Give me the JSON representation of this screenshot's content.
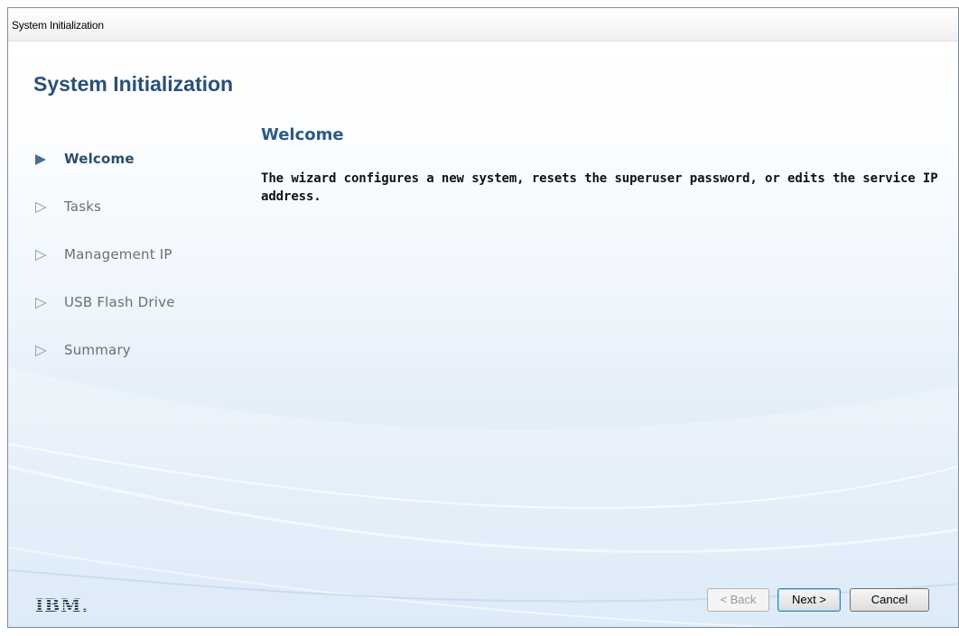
{
  "window": {
    "title": "System Initialization"
  },
  "header": {
    "title": "System Initialization"
  },
  "steps": [
    {
      "label": "Welcome",
      "active": true
    },
    {
      "label": "Tasks",
      "active": false
    },
    {
      "label": "Management IP",
      "active": false
    },
    {
      "label": "USB Flash Drive",
      "active": false
    },
    {
      "label": "Summary",
      "active": false
    }
  ],
  "content": {
    "title": "Welcome",
    "text": "The wizard configures a new system, resets the superuser password, or edits the service IP address."
  },
  "footer": {
    "logo": "IBM.",
    "back_label": "< Back",
    "back_enabled": false,
    "next_label": "Next >",
    "cancel_label": "Cancel"
  },
  "colors": {
    "title_blue": "#2b4f77",
    "active_step": "#2e4c6b",
    "inactive_step": "#6f6f6f",
    "background_bottom": "#d2e4f6"
  },
  "icons": {
    "active_step": "filled-triangle-right",
    "inactive_step": "outline-triangle-right"
  }
}
